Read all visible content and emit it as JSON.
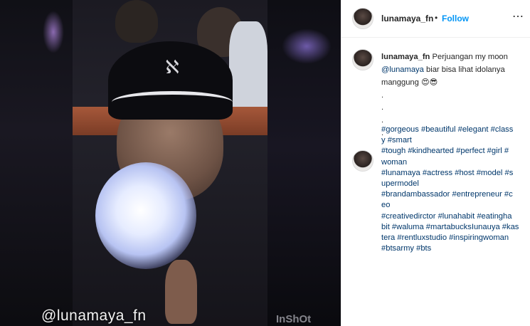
{
  "media": {
    "watermark": "@lunamaya_fn",
    "app_watermark": "InShOt"
  },
  "post": {
    "username": "lunamaya_fn",
    "separator": "•",
    "follow_label": "Follow",
    "more_icon": "⋯"
  },
  "caption": {
    "username": "lunamaya_fn",
    "text_before_mention": "Perjuangan my moon",
    "mention": "@lunamaya",
    "text_after_mention": "biar bisa lihat idolanya manggung",
    "emojis": "😍😎",
    "dots": [
      ".",
      ".",
      ".",
      "."
    ]
  },
  "hashtags": {
    "lines": [
      "#gorgeous #beautiful #elegant #class",
      "y #smart",
      "#tough #kindhearted #perfect #girl #",
      "woman",
      "#lunamaya #actress #host #model #s",
      "upermodel",
      "#brandambassador #entrepreneur #c",
      "eo",
      "#creativedirctor #lunahabit #eatingha",
      "bit #waluma #martabucksIunauya #kas",
      "tera #rentluxstudio #inspiringwoman",
      "#btsarmy #bts"
    ]
  },
  "colors": {
    "accent": "#0095f6",
    "link": "#00376b",
    "text": "#262626"
  }
}
